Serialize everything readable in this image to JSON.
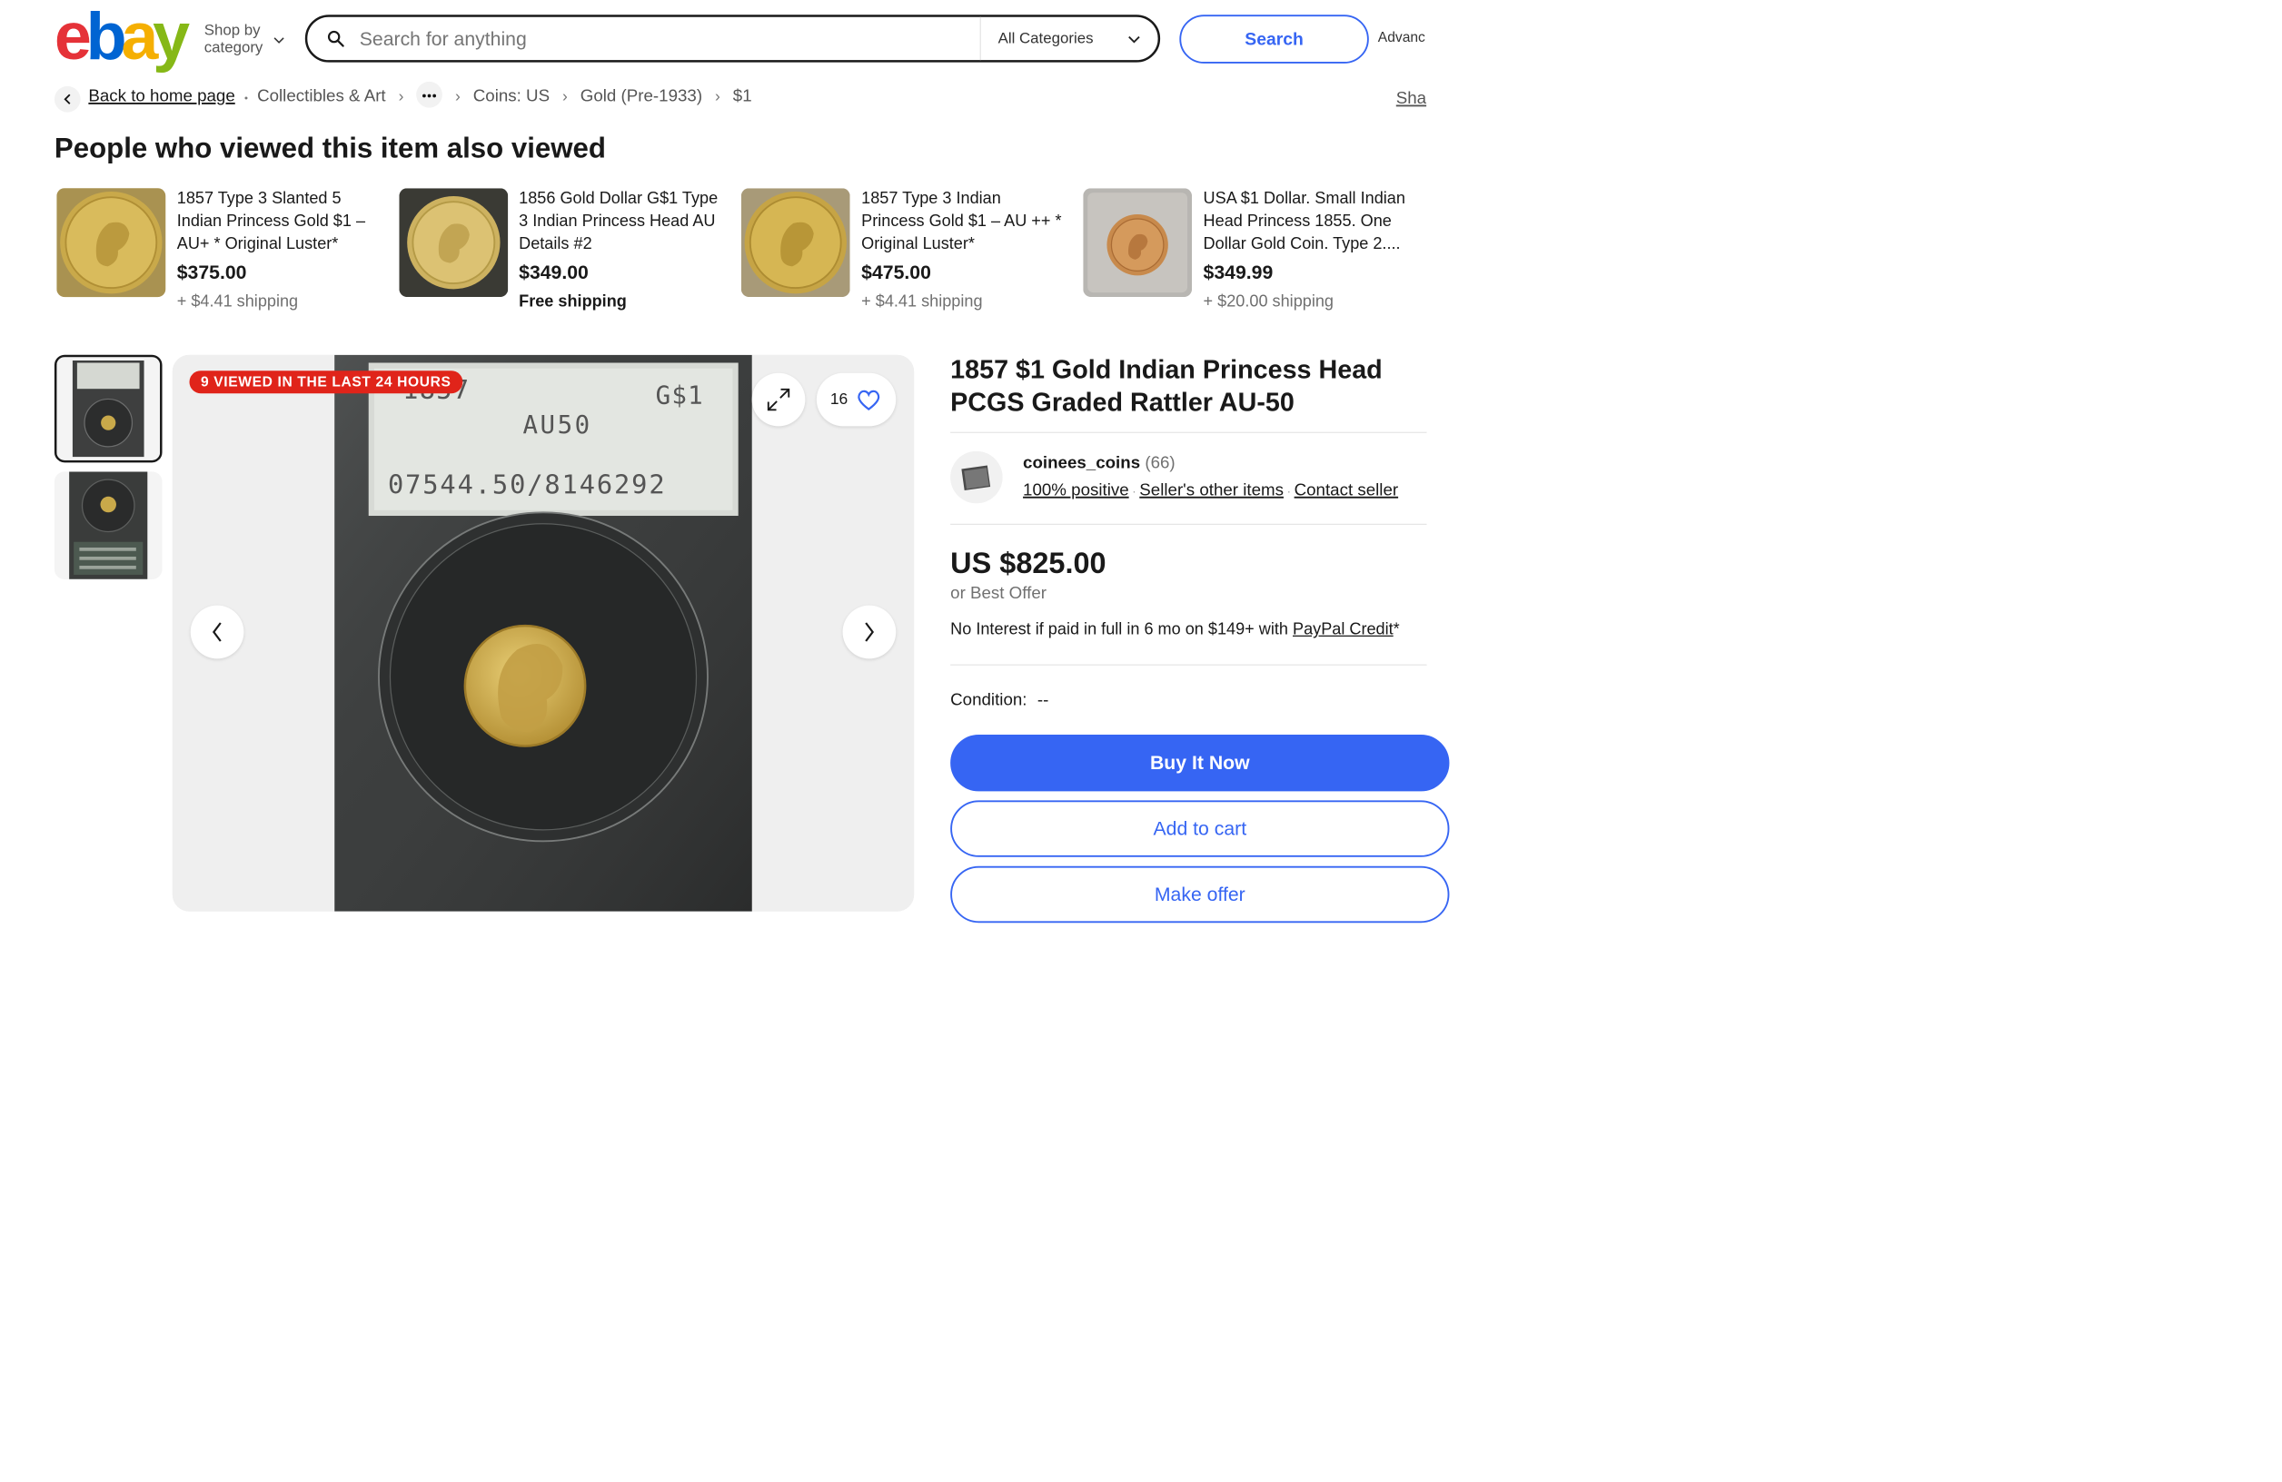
{
  "header": {
    "logo_letters": [
      "e",
      "b",
      "a",
      "y"
    ],
    "shop_by_line1": "Shop by",
    "shop_by_line2": "category",
    "search_placeholder": "Search for anything",
    "category_select": "All Categories",
    "search_button": "Search",
    "advanced_link": "Advanc"
  },
  "breadcrumb": {
    "back": "Back to home page",
    "items": [
      "Collectibles & Art",
      "Coins: US",
      "Gold (Pre-1933)",
      "$1"
    ],
    "share": "Sha"
  },
  "also_viewed": {
    "title": "People who viewed this item also viewed",
    "items": [
      {
        "title": "1857 Type 3 Slanted 5 Indian Princess Gold $1 – AU+ * Original Luster*",
        "price": "$375.00",
        "shipping": "+ $4.41 shipping"
      },
      {
        "title": "1856 Gold Dollar G$1 Type 3 Indian Princess Head AU Details #2",
        "price": "$349.00",
        "shipping": "Free shipping"
      },
      {
        "title": "1857 Type 3 Indian Princess Gold $1 – AU ++ * Original Luster*",
        "price": "$475.00",
        "shipping": "+ $4.41 shipping"
      },
      {
        "title": "USA $1 Dollar. Small Indian Head Princess 1855. One Dollar Gold Coin. Type 2....",
        "price": "$349.99",
        "shipping": "+ $20.00 shipping"
      }
    ]
  },
  "gallery": {
    "badge": "9 VIEWED IN THE LAST 24 HOURS",
    "watch_count": "16",
    "slab_text": {
      "year": "1857",
      "denom": "G$1",
      "grade": "AU50",
      "serial": "07544.50/8146292"
    }
  },
  "listing": {
    "title": "1857 $1 Gold Indian Princess Head PCGS Graded Rattler AU-50",
    "seller_name": "coinees_coins",
    "seller_feedback": "(66)",
    "seller_positive": "100% positive",
    "seller_other_items": "Seller's other items",
    "contact_seller": "Contact seller",
    "price": "US $825.00",
    "best_offer": "or Best Offer",
    "credit_text": "No Interest if paid in full in 6 mo on $149+ with ",
    "credit_link": "PayPal Credit",
    "credit_suffix": "*",
    "condition_label": "Condition:",
    "condition_value": "--",
    "buy_now": "Buy It Now",
    "add_to_cart": "Add to cart",
    "make_offer": "Make offer"
  },
  "colors": {
    "logo": [
      "#e53238",
      "#0064d2",
      "#f5af02",
      "#86b817"
    ],
    "accent": "#3665f3",
    "badge": "#e0241a"
  }
}
